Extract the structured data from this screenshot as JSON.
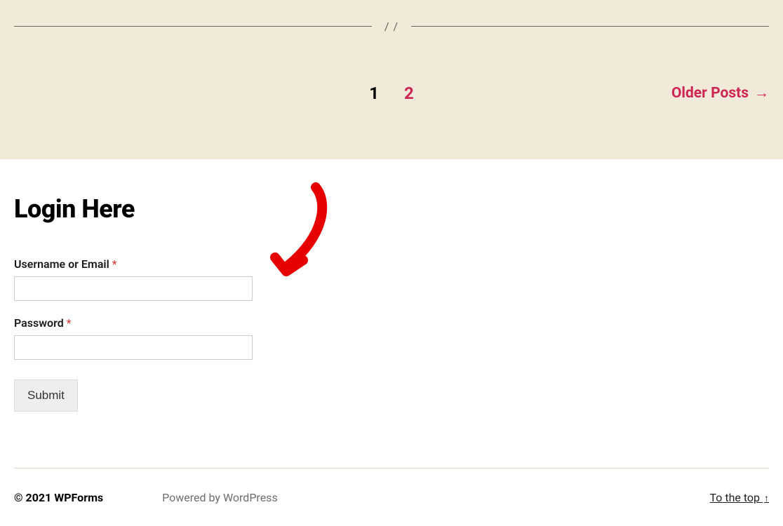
{
  "pagination": {
    "current": "1",
    "next": "2",
    "older_label": "Older Posts"
  },
  "login": {
    "heading": "Login Here",
    "username_label": "Username or Email",
    "password_label": "Password",
    "required_mark": "*",
    "submit_label": "Submit"
  },
  "footer": {
    "copyright": "© 2021 WPForms",
    "powered": "Powered by WordPress",
    "to_top": "To the top"
  }
}
